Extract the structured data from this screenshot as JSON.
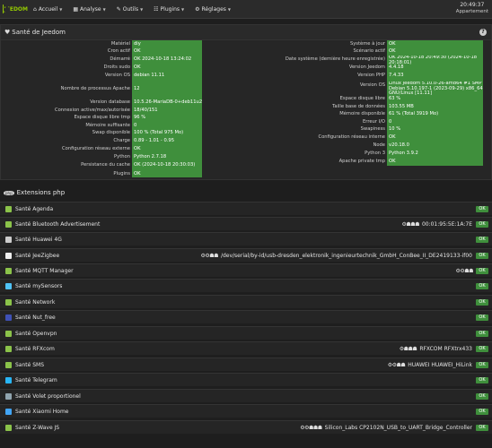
{
  "navbar": {
    "logo": "JEEDOM",
    "menu": [
      {
        "icon": "home-icon",
        "glyph": "⌂",
        "label": "Accueil"
      },
      {
        "icon": "chart-icon",
        "glyph": "▦",
        "label": "Analyse"
      },
      {
        "icon": "wrench-icon",
        "glyph": "✎",
        "label": "Outils"
      },
      {
        "icon": "tasks-icon",
        "glyph": "☷",
        "label": "Plugins"
      },
      {
        "icon": "cogs-icon",
        "glyph": "⚙",
        "label": "Réglages"
      }
    ],
    "time": "20:49:37",
    "location": "Appartement"
  },
  "health": {
    "title": "Santé de Jeedom",
    "left": [
      {
        "label": "Matériel",
        "value": "diy"
      },
      {
        "label": "Cron actif",
        "value": "OK"
      },
      {
        "label": "Démarré",
        "value": "OK 2024-10-18 13:24:02"
      },
      {
        "label": "Droits sudo",
        "value": "OK"
      },
      {
        "label": "Version OS",
        "value": "debian 11.11"
      },
      {
        "label": "Nombre de processus Apache",
        "value": "12"
      },
      {
        "label": "Version database",
        "value": "10.5.26-MariaDB-0+deb11u2"
      },
      {
        "label": "Connexion active/max/autorisée",
        "value": "18/40/151"
      },
      {
        "label": "Espace disque libre tmp",
        "value": "96 %"
      },
      {
        "label": "Mémoire suffisante",
        "value": "0"
      },
      {
        "label": "Swap disponible",
        "value": "100 % (Total 975 Mo)"
      },
      {
        "label": "Charge",
        "value": "0.89 - 1.01 - 0.95"
      },
      {
        "label": "Configuration réseau externe",
        "value": "OK"
      },
      {
        "label": "Python",
        "value": "Python 2.7.18"
      },
      {
        "label": "Persistance du cache",
        "value": "OK (2024-10-18 20:30:03)"
      },
      {
        "label": "Plugins",
        "value": "OK"
      }
    ],
    "right": [
      {
        "label": "Système à jour",
        "value": "OK"
      },
      {
        "label": "Scénario actif",
        "value": "OK"
      },
      {
        "label": "Date système (dernière heure enregistrée)",
        "value": "OK 2024-10-18 20:49:30 (2024-10-18 20:18:01)"
      },
      {
        "label": "Version Jeedom",
        "value": "4.4.18"
      },
      {
        "label": "Version PHP",
        "value": "7.4.33"
      },
      {
        "label": "Version OS",
        "value": "Linux Jeedom 5.10.0-26-amd64 #1 SMP Debian 5.10.197-1 (2023-09-29) x86_64 GNU/Linux [11.11]"
      },
      {
        "label": "Espace disque libre",
        "value": "63 %"
      },
      {
        "label": "Taille base de données",
        "value": "103.55 MB"
      },
      {
        "label": "Mémoire disponible",
        "value": "61 % (Total 3919 Mo)"
      },
      {
        "label": "Erreur I/O",
        "value": "0"
      },
      {
        "label": "Swapiness",
        "value": "10 %"
      },
      {
        "label": "Configuration réseau interne",
        "value": "OK"
      },
      {
        "label": "Node",
        "value": "v20.18.0"
      },
      {
        "label": "Python 3",
        "value": "Python 3.9.2"
      },
      {
        "label": "Apache private tmp",
        "value": "OK"
      }
    ]
  },
  "extensions": {
    "title": "Extensions php",
    "badge": "php",
    "items": [
      {
        "label": "Santé Agenda",
        "tools": "",
        "detail": "",
        "status": "OK",
        "color": "#8bc34a"
      },
      {
        "label": "Santé Bluetooth Advertisement",
        "tools": "⚙☗☗☗",
        "detail": "00:01:95:5E:1A:7E",
        "status": "OK",
        "color": "#8bc34a"
      },
      {
        "label": "Santé Huawei 4G",
        "tools": "",
        "detail": "",
        "status": "OK",
        "color": "#cccccc"
      },
      {
        "label": "Santé JeeZigbee",
        "tools": "⚙⚙☗☗",
        "detail": "/dev/serial/by-id/usb-dresden_elektronik_ingenieurtechnik_GmbH_ConBee_II_DE2419133-if00",
        "status": "OK",
        "color": "#eeeeee"
      },
      {
        "label": "Santé MQTT Manager",
        "tools": "⚙⚙☗☗",
        "detail": "",
        "status": "OK",
        "color": "#8bc34a"
      },
      {
        "label": "Santé mySensors",
        "tools": "",
        "detail": "",
        "status": "OK",
        "color": "#4fc3f7"
      },
      {
        "label": "Santé Network",
        "tools": "",
        "detail": "",
        "status": "OK",
        "color": "#8bc34a"
      },
      {
        "label": "Santé Nut_free",
        "tools": "",
        "detail": "",
        "status": "OK",
        "color": "#3f51b5"
      },
      {
        "label": "Santé Openvpn",
        "tools": "",
        "detail": "",
        "status": "OK",
        "color": "#8bc34a"
      },
      {
        "label": "Santé RFXcom",
        "tools": "⚙☗☗☗",
        "detail": "RFXCOM RFXtrx433",
        "status": "OK",
        "color": "#8bc34a"
      },
      {
        "label": "Santé SMS",
        "tools": "⚙⚙☗☗",
        "detail": "HUAWEI HUAWEI_HiLink",
        "status": "OK",
        "color": "#8bc34a"
      },
      {
        "label": "Santé Telegram",
        "tools": "",
        "detail": "",
        "status": "OK",
        "color": "#29b6f6"
      },
      {
        "label": "Santé Volet proportionel",
        "tools": "",
        "detail": "",
        "status": "OK",
        "color": "#90a4ae"
      },
      {
        "label": "Santé Xiaomi Home",
        "tools": "",
        "detail": "",
        "status": "OK",
        "color": "#42a5f5"
      },
      {
        "label": "Santé Z-Wave JS",
        "tools": "⚙⚙☗☗☗",
        "detail": "Silicon_Labs CP2102N_USB_to_UART_Bridge_Controller",
        "status": "OK",
        "color": "#8bc34a"
      }
    ]
  }
}
